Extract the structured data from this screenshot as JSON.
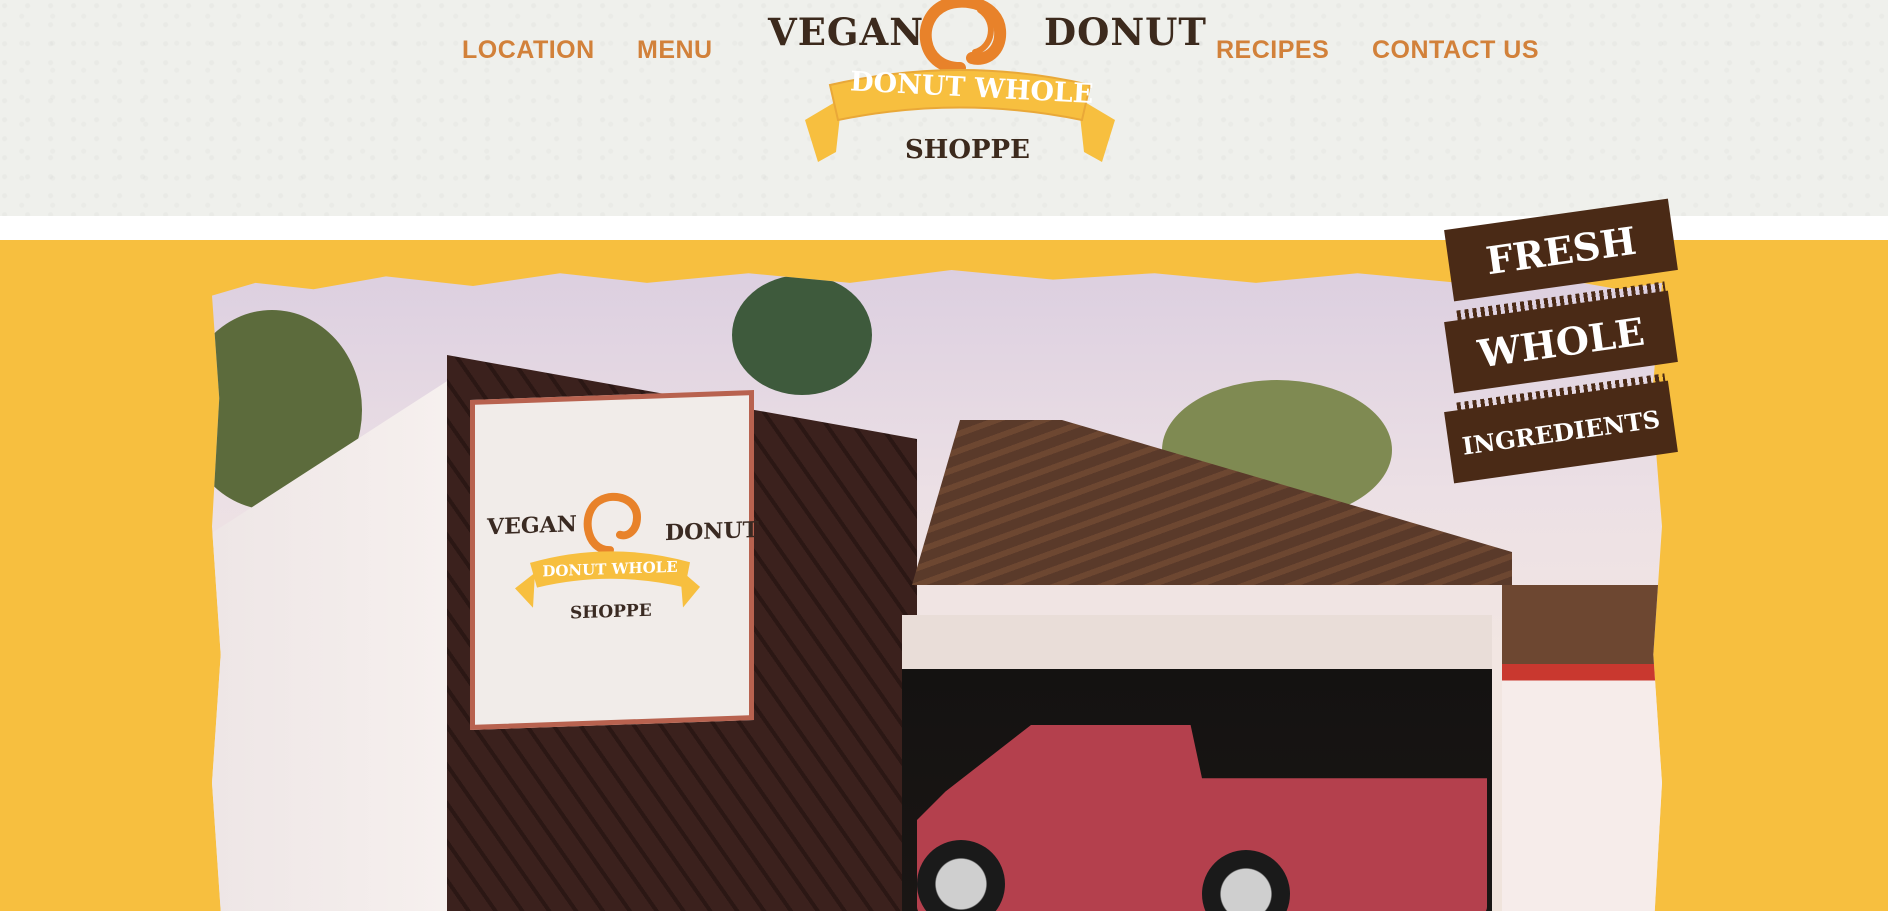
{
  "nav": {
    "location": "LOCATION",
    "menu": "MENU",
    "recipes": "RECIPES",
    "contact": "CONTACT US"
  },
  "logo": {
    "vegan": "VEGAN",
    "donut": "DONUT",
    "banner": "DONUT WHOLE",
    "shoppe": "SHOPPE"
  },
  "sign_logo": {
    "vegan": "VEGAN",
    "donut": "DONUT",
    "banner": "DONUT WHOLE",
    "shoppe": "SHOPPE"
  },
  "badge": {
    "line1": "FRESH",
    "line2": "WHOLE",
    "line3": "INGREDIENTS"
  },
  "colors": {
    "nav_text": "#d2813a",
    "accent_yellow": "#f7bf3f",
    "logo_orange": "#e8822a",
    "badge_brown": "#4a2a16"
  }
}
